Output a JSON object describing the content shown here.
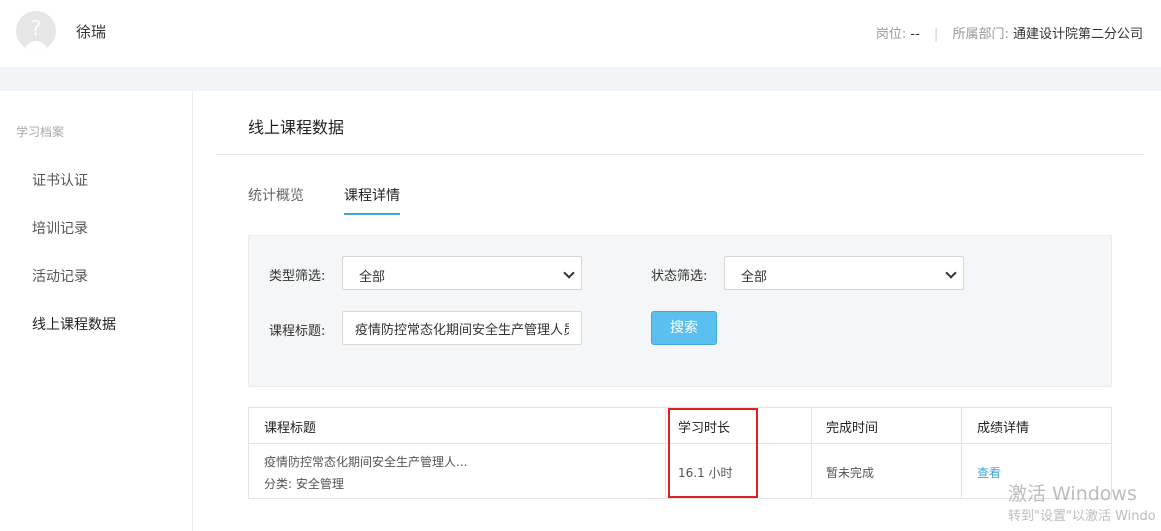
{
  "header": {
    "username": "徐瑞",
    "position_label": "岗位:",
    "position_value": "--",
    "separator": "|",
    "department_label": "所属部门:",
    "department_value": "通建设计院第二分公司"
  },
  "sidebar": {
    "heading": "学习档案",
    "items": [
      {
        "label": "证书认证"
      },
      {
        "label": "培训记录"
      },
      {
        "label": "活动记录"
      },
      {
        "label": "线上课程数据"
      }
    ]
  },
  "main": {
    "title": "线上课程数据",
    "tabs": [
      {
        "label": "统计概览"
      },
      {
        "label": "课程详情"
      }
    ]
  },
  "filters": {
    "type_label": "类型筛选:",
    "type_value": "全部",
    "status_label": "状态筛选:",
    "status_value": "全部",
    "title_label": "课程标题:",
    "title_value": "疫情防控常态化期间安全生产管理人员",
    "search_label": "搜索"
  },
  "table": {
    "headers": [
      "课程标题",
      "学习时长",
      "完成时间",
      "成绩详情"
    ],
    "rows": [
      {
        "title": "疫情防控常态化期间安全生产管理人...",
        "category": "分类:  安全管理",
        "duration": "16.1 小时",
        "completion": "暂未完成",
        "detail": "查看"
      }
    ]
  },
  "watermark": {
    "line1": "激活 Windows",
    "line2": "转到\"设置\"以激活 Windo"
  },
  "colors": {
    "accent": "#3ea7d6",
    "search_button": "#5bc0f0",
    "highlight": "#e02020"
  }
}
